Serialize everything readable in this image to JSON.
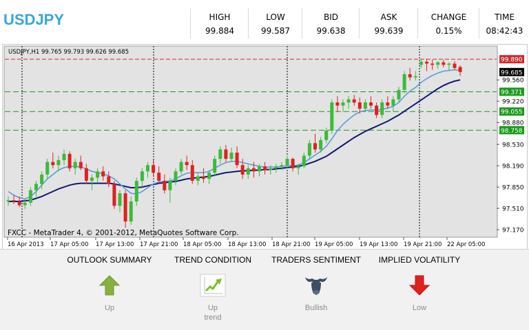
{
  "header": {
    "symbol": "USDJPY",
    "quotes": [
      {
        "label": "HIGH",
        "value": "99.884"
      },
      {
        "label": "LOW",
        "value": "99.587"
      },
      {
        "label": "BID",
        "value": "99.638"
      },
      {
        "label": "ASK",
        "value": "99.639"
      },
      {
        "label": "CHANGE",
        "value": "0.15%"
      },
      {
        "label": "TIME",
        "value": "08:42:43"
      }
    ]
  },
  "chart": {
    "info": "USDJPY,H1  99.765 99.793 99.626 99.685",
    "footer": "FXCC - MetaTrader 4, © 2001-2012, MetaQuotes Software Corp.",
    "price_ticks": [
      "99.560",
      "99.220",
      "98.880",
      "98.530",
      "98.190",
      "97.850",
      "97.510",
      "97.170"
    ],
    "time_labels": [
      "16 Apr 2013",
      "17 Apr 05:00",
      "17 Apr 13:00",
      "17 Apr 21:00",
      "18 Apr 05:00",
      "18 Apr 13:00",
      "18 Apr 21:00",
      "19 Apr 05:00",
      "19 Apr 13:00",
      "19 Apr 21:00",
      "22 Apr 05:00"
    ],
    "red_level": {
      "value": "99.890",
      "color": "#d0292f"
    },
    "green_levels": [
      {
        "value": "99.371",
        "color": "#1a9a1a"
      },
      {
        "value": "99.055",
        "color": "#1a9a1a"
      },
      {
        "value": "98.758",
        "color": "#1a9a1a"
      }
    ],
    "current_price": "99.685",
    "colors": {
      "up": "#3cba3c",
      "down": "#e02020",
      "fast_ma": "#5b9bdc",
      "slow_ma": "#0d1a6e",
      "background": "#e3e3e3",
      "grid": "#000000"
    }
  },
  "chart_data": {
    "type": "candlestick",
    "title": "USDJPY,H1",
    "ylim": [
      97.05,
      100.1
    ],
    "ticks_y": [
      99.56,
      99.22,
      98.88,
      98.53,
      98.19,
      97.85,
      97.51,
      97.17
    ],
    "candles": [
      [
        97.62,
        97.7,
        97.55,
        97.64
      ],
      [
        97.64,
        97.72,
        97.58,
        97.62
      ],
      [
        97.62,
        97.7,
        97.53,
        97.56
      ],
      [
        97.56,
        97.66,
        97.5,
        97.6
      ],
      [
        97.6,
        97.85,
        97.55,
        97.8
      ],
      [
        97.8,
        97.95,
        97.7,
        97.9
      ],
      [
        97.9,
        98.1,
        97.82,
        98.05
      ],
      [
        98.05,
        98.3,
        97.98,
        98.25
      ],
      [
        98.25,
        98.4,
        98.15,
        98.2
      ],
      [
        98.2,
        98.35,
        98.1,
        98.28
      ],
      [
        98.28,
        98.45,
        98.2,
        98.38
      ],
      [
        98.38,
        98.42,
        98.1,
        98.15
      ],
      [
        98.15,
        98.3,
        98.05,
        98.25
      ],
      [
        98.25,
        98.35,
        98.12,
        98.15
      ],
      [
        98.15,
        98.22,
        97.9,
        97.95
      ],
      [
        97.95,
        98.05,
        97.8,
        98.0
      ],
      [
        98.0,
        98.15,
        97.92,
        98.1
      ],
      [
        98.1,
        98.18,
        97.95,
        98.02
      ],
      [
        98.02,
        98.1,
        97.85,
        97.9
      ],
      [
        97.9,
        97.95,
        97.5,
        97.55
      ],
      [
        97.55,
        97.8,
        97.45,
        97.75
      ],
      [
        97.75,
        97.8,
        97.2,
        97.3
      ],
      [
        97.3,
        97.7,
        97.25,
        97.62
      ],
      [
        97.62,
        98.0,
        97.55,
        97.95
      ],
      [
        97.95,
        98.15,
        97.85,
        98.1
      ],
      [
        98.1,
        98.25,
        98.0,
        98.2
      ],
      [
        98.2,
        98.28,
        98.02,
        98.08
      ],
      [
        98.08,
        98.18,
        97.9,
        97.95
      ],
      [
        97.95,
        98.05,
        97.75,
        97.8
      ],
      [
        97.8,
        98.0,
        97.6,
        97.95
      ],
      [
        97.95,
        98.15,
        97.88,
        98.1
      ],
      [
        98.1,
        98.3,
        98.05,
        98.25
      ],
      [
        98.25,
        98.35,
        98.12,
        98.2
      ],
      [
        98.2,
        98.28,
        97.9,
        97.95
      ],
      [
        97.95,
        98.08,
        97.88,
        98.02
      ],
      [
        98.02,
        98.15,
        97.92,
        97.98
      ],
      [
        97.98,
        98.12,
        97.9,
        98.08
      ],
      [
        98.08,
        98.35,
        98.02,
        98.3
      ],
      [
        98.3,
        98.5,
        98.22,
        98.45
      ],
      [
        98.45,
        98.52,
        98.25,
        98.3
      ],
      [
        98.3,
        98.48,
        98.25,
        98.4
      ],
      [
        98.4,
        98.5,
        98.15,
        98.2
      ],
      [
        98.2,
        98.3,
        97.98,
        98.05
      ],
      [
        98.05,
        98.2,
        97.98,
        98.15
      ],
      [
        98.15,
        98.25,
        98.0,
        98.1
      ],
      [
        98.1,
        98.22,
        98.02,
        98.18
      ],
      [
        98.18,
        98.25,
        98.05,
        98.12
      ],
      [
        98.12,
        98.2,
        98.05,
        98.15
      ],
      [
        98.15,
        98.22,
        98.08,
        98.18
      ],
      [
        98.18,
        98.25,
        98.12,
        98.2
      ],
      [
        98.2,
        98.35,
        98.15,
        98.3
      ],
      [
        98.3,
        98.32,
        98.1,
        98.15
      ],
      [
        98.15,
        98.22,
        98.05,
        98.18
      ],
      [
        98.18,
        98.4,
        98.15,
        98.35
      ],
      [
        98.35,
        98.6,
        98.3,
        98.55
      ],
      [
        98.55,
        98.7,
        98.4,
        98.45
      ],
      [
        98.45,
        98.65,
        98.4,
        98.6
      ],
      [
        98.6,
        98.8,
        98.55,
        98.75
      ],
      [
        98.75,
        99.25,
        98.7,
        99.2
      ],
      [
        99.2,
        99.3,
        99.05,
        99.15
      ],
      [
        99.15,
        99.25,
        99.05,
        99.2
      ],
      [
        99.2,
        99.3,
        99.1,
        99.25
      ],
      [
        99.25,
        99.32,
        99.15,
        99.2
      ],
      [
        99.2,
        99.28,
        99.02,
        99.1
      ],
      [
        99.1,
        99.25,
        99.05,
        99.2
      ],
      [
        99.2,
        99.3,
        99.1,
        99.15
      ],
      [
        99.15,
        99.2,
        98.95,
        99.0
      ],
      [
        99.0,
        99.25,
        98.95,
        99.2
      ],
      [
        99.2,
        99.3,
        99.1,
        99.15
      ],
      [
        99.15,
        99.3,
        99.05,
        99.25
      ],
      [
        99.25,
        99.45,
        99.2,
        99.4
      ],
      [
        99.4,
        99.7,
        99.35,
        99.65
      ],
      [
        99.65,
        99.75,
        99.55,
        99.6
      ],
      [
        99.6,
        99.7,
        99.55,
        99.62
      ],
      [
        99.8,
        99.9,
        99.75,
        99.85
      ],
      [
        99.85,
        99.9,
        99.7,
        99.82
      ],
      [
        99.82,
        99.88,
        99.72,
        99.8
      ],
      [
        99.8,
        99.86,
        99.74,
        99.84
      ],
      [
        99.84,
        99.88,
        99.76,
        99.8
      ],
      [
        99.8,
        99.84,
        99.7,
        99.82
      ],
      [
        99.82,
        99.86,
        99.72,
        99.75
      ],
      [
        99.765,
        99.793,
        99.626,
        99.685
      ]
    ],
    "ma_fast": [
      97.78,
      97.72,
      97.68,
      97.66,
      97.7,
      97.78,
      97.88,
      97.98,
      98.05,
      98.12,
      98.16,
      98.18,
      98.18,
      98.17,
      98.14,
      98.1,
      98.08,
      98.06,
      98.03,
      97.98,
      97.9,
      97.82,
      97.75,
      97.74,
      97.78,
      97.84,
      97.9,
      97.93,
      97.94,
      97.95,
      97.98,
      98.03,
      98.07,
      98.08,
      98.08,
      98.08,
      98.1,
      98.15,
      98.2,
      98.24,
      98.26,
      98.26,
      98.24,
      98.22,
      98.2,
      98.18,
      98.17,
      98.17,
      98.17,
      98.18,
      98.19,
      98.19,
      98.2,
      98.24,
      98.3,
      98.36,
      98.42,
      98.5,
      98.62,
      98.75,
      98.85,
      98.93,
      99.0,
      99.05,
      99.07,
      99.08,
      99.08,
      99.09,
      99.11,
      99.14,
      99.2,
      99.3,
      99.38,
      99.44,
      99.52,
      99.58,
      99.63,
      99.67,
      99.7,
      99.71,
      99.72,
      99.71
    ],
    "ma_slow": [
      97.62,
      97.62,
      97.62,
      97.63,
      97.64,
      97.67,
      97.7,
      97.74,
      97.78,
      97.82,
      97.85,
      97.88,
      97.9,
      97.91,
      97.91,
      97.91,
      97.91,
      97.91,
      97.91,
      97.9,
      97.88,
      97.86,
      97.84,
      97.84,
      97.85,
      97.87,
      97.89,
      97.91,
      97.92,
      97.93,
      97.94,
      97.96,
      97.98,
      97.99,
      98.0,
      98.01,
      98.02,
      98.04,
      98.06,
      98.08,
      98.09,
      98.1,
      98.11,
      98.11,
      98.12,
      98.12,
      98.13,
      98.13,
      98.14,
      98.15,
      98.16,
      98.17,
      98.18,
      98.2,
      98.23,
      98.26,
      98.3,
      98.34,
      98.4,
      98.46,
      98.52,
      98.58,
      98.64,
      98.69,
      98.74,
      98.78,
      98.82,
      98.86,
      98.9,
      98.95,
      99.0,
      99.06,
      99.12,
      99.18,
      99.24,
      99.3,
      99.36,
      99.42,
      99.47,
      99.51,
      99.54,
      99.56
    ]
  },
  "panel": {
    "items": [
      {
        "title": "OUTLOOK SUMMARY",
        "value": "Up"
      },
      {
        "title": "TREND CONDITION",
        "value": "Up\ntrend"
      },
      {
        "title": "TRADERS SENTIMENT",
        "value": "Bullish"
      },
      {
        "title": "IMPLIED VOLATILITY",
        "value": "Low"
      }
    ]
  }
}
